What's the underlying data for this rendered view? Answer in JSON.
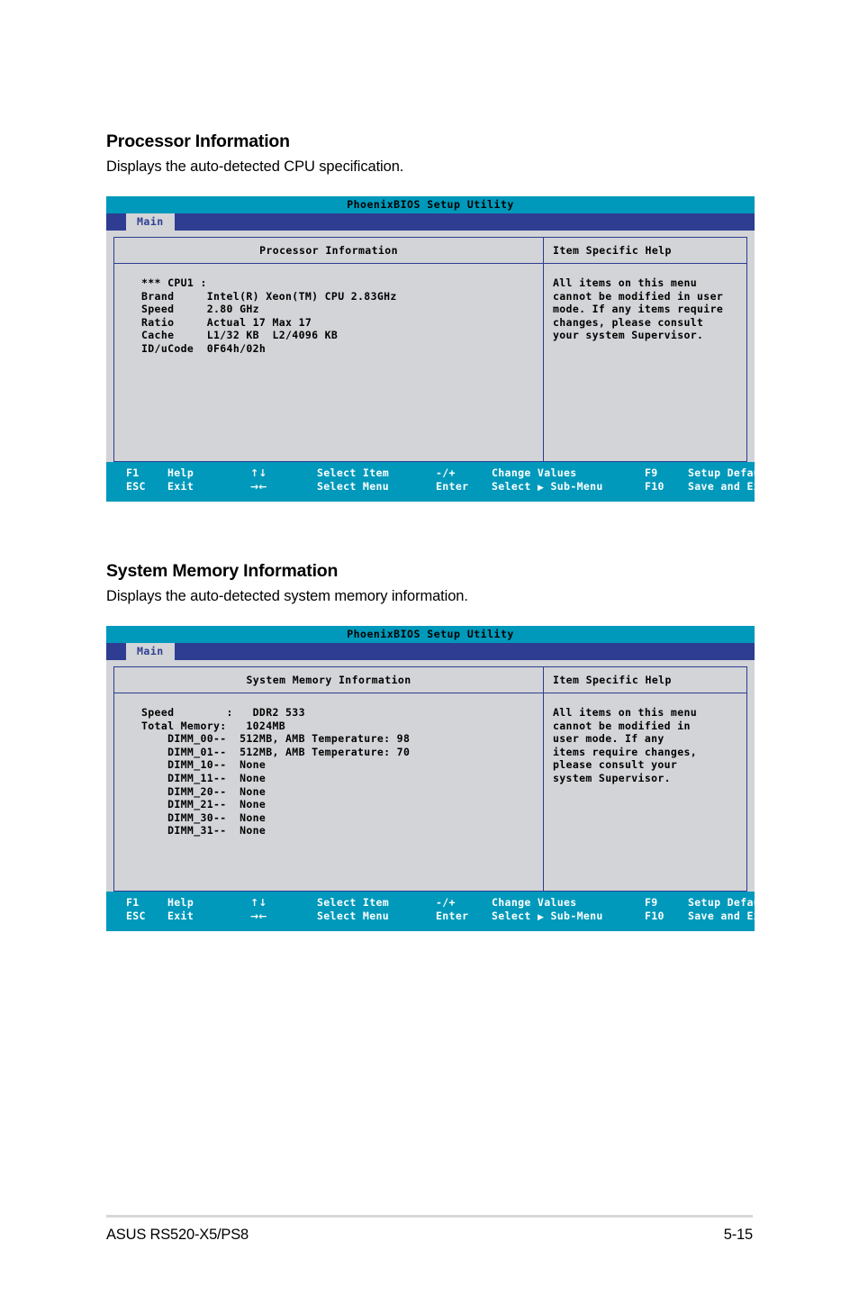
{
  "sections": [
    {
      "title": "Processor Information",
      "description": "Displays the auto-detected CPU specification.",
      "screen": {
        "title_bar": "PhoenixBIOS Setup Utility",
        "menu_tab": "Main",
        "left_header": "Processor Information",
        "right_header": "Item Specific Help",
        "left_lines": [
          "*** CPU1 :",
          "Brand     Intel(R) Xeon(TM) CPU 2.83GHz",
          "Speed     2.80 GHz",
          "Ratio     Actual 17 Max 17",
          "Cache     L1/32 KB  L2/4096 KB",
          "ID/uCode  0F64h/02h"
        ],
        "help_lines": [
          "All items on this menu",
          "cannot be modified in user",
          "mode. If any items require",
          "changes, please consult",
          "your system Supervisor."
        ]
      }
    },
    {
      "title": "System Memory Information",
      "description": "Displays the auto-detected system memory information.",
      "screen": {
        "title_bar": "PhoenixBIOS Setup Utility",
        "menu_tab": "Main",
        "left_header": "System Memory Information",
        "right_header": "Item Specific Help",
        "left_lines": [
          "Speed        :   DDR2 533",
          "Total Memory:   1024MB",
          "    DIMM_00--  512MB, AMB Temperature: 98",
          "    DIMM_01--  512MB, AMB Temperature: 70",
          "    DIMM_10--  None",
          "    DIMM_11--  None",
          "    DIMM_20--  None",
          "    DIMM_21--  None",
          "    DIMM_30--  None",
          "    DIMM_31--  None"
        ],
        "help_lines": [
          "All items on this menu",
          "cannot be modified in",
          "user mode. If any",
          "items require changes,",
          "please consult your",
          "system Supervisor."
        ]
      }
    }
  ],
  "legend": {
    "row1": {
      "key": "F1",
      "label": "Help",
      "arrow": "↑↓",
      "action": "Select Item",
      "key2": "-/+",
      "action2": "Change Values",
      "key3": "F9",
      "action3": "Setup Defaults"
    },
    "row2": {
      "key": "ESC",
      "label": "Exit",
      "arrow": "→←",
      "action": "Select Menu",
      "key2": "Enter",
      "action2_pre": "Select",
      "action2_tri": "▶",
      "action2_post": "Sub-Menu",
      "key3": "F10",
      "action3": "Save and Exit"
    }
  },
  "footer": {
    "model": "ASUS RS520-X5/PS8",
    "page_number": "5-15"
  },
  "colors": {
    "title_bar": "#0099bb",
    "menu_bar": "#2e3d92",
    "panel_bg": "#d2d4d7",
    "border": "#2e3d92",
    "footer_bar": "#0099bb"
  }
}
